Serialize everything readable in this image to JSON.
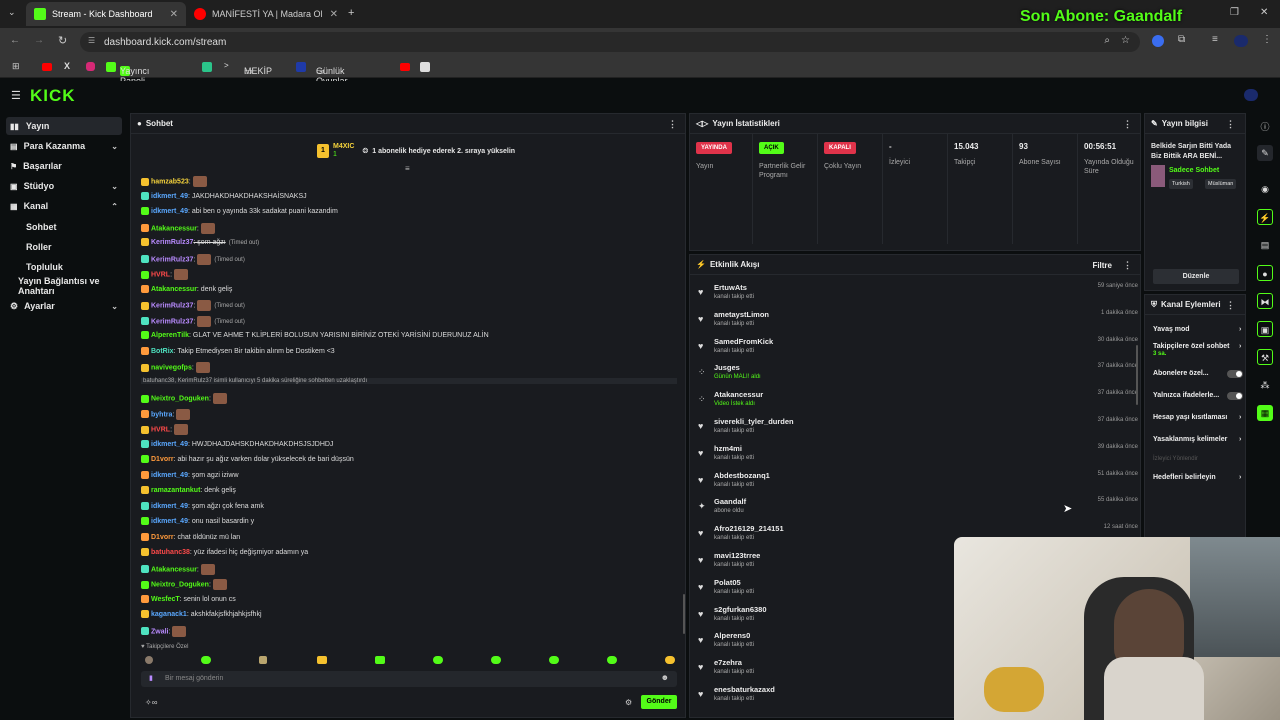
{
  "browser": {
    "tabs": [
      {
        "title": "Stream - Kick Dashboard",
        "active": true
      },
      {
        "title": "MANİFESTİ YA | Madara Olduk",
        "active": false
      }
    ],
    "url": "dashboard.kick.com/stream",
    "bookmarks": [
      "Yayıncı Paneli",
      "MEKİP",
      "Günlük Oyunlar"
    ]
  },
  "overlay": {
    "text": "Son Abone: Gaandalf"
  },
  "app": {
    "logo": "KICK"
  },
  "sidebar": {
    "items": [
      {
        "label": "Yayın"
      },
      {
        "label": "Para Kazanma"
      },
      {
        "label": "Başarılar"
      },
      {
        "label": "Stüdyo"
      },
      {
        "label": "Kanal"
      },
      {
        "label": "Yayın Bağlantısı ve Anahtarı"
      },
      {
        "label": "Ayarlar"
      }
    ],
    "sub_items": [
      "Sohbet",
      "Roller",
      "Topluluk"
    ]
  },
  "chat": {
    "title": "Sohbet",
    "pinned_user": "M4XIC",
    "pinned_count": "1",
    "pinned_text": "1 abonelik hediye ederek 2. sıraya yükselin",
    "timed_out": "(Timed out)",
    "lines": [
      {
        "user": "hamzab523",
        "msg": ":",
        "color": "u-yellow"
      },
      {
        "user": "idkmert_49",
        "msg": ": JAKDHAKDHAKDHAKSHAİSNAKSJ",
        "color": "u-blue"
      },
      {
        "user": "idkmert_49",
        "msg": ": abi ben o yayında 33k sadakat puani kazandim",
        "color": "u-blue"
      },
      {
        "user": "Atakancessur",
        "msg": ":",
        "color": "u-green"
      },
      {
        "user": "KerimRulz37",
        "msg": ": şom ağzı",
        "color": "u-purple"
      },
      {
        "user": "KerimRulz37",
        "msg": ":",
        "color": "u-purple"
      },
      {
        "user": "HVRL",
        "msg": ":",
        "color": "u-red"
      },
      {
        "user": "Atakancessur",
        "msg": ": denk geliş",
        "color": "u-green"
      },
      {
        "user": "KerimRulz37",
        "msg": ":",
        "color": "u-purple"
      },
      {
        "user": "KerimRulz37",
        "msg": ":",
        "color": "u-purple"
      },
      {
        "user": "AlperenTilk",
        "msg": ": GLAT VE AHME T KLİPLERİ BOLUSUN YARISINI BİRİNİZ OTEKİ YARİSİNİ DUERUNUZ ALİN",
        "color": "u-green"
      },
      {
        "user": "BotRix",
        "msg": ": Takip Etmediysen Bir takibin alınm be Dostikem <3",
        "color": "u-teal"
      },
      {
        "user": "navivegofps",
        "msg": ":",
        "color": "u-green"
      },
      {
        "user": "",
        "msg": "batuhanc38, KerimRulz37 isimli kullanıcıyı 5 dakika süreliğine sohbetten uzaklaştırdı",
        "color": ""
      },
      {
        "user": "Neixtro_Doguken",
        "msg": ":",
        "color": "u-green"
      },
      {
        "user": "byhtra",
        "msg": ":",
        "color": "u-blue"
      },
      {
        "user": "HVRL",
        "msg": ":",
        "color": "u-red"
      },
      {
        "user": "idkmert_49",
        "msg": ": HWJDHAJDAHSKDHAKDHAKDHSJSJDHDJ",
        "color": "u-blue"
      },
      {
        "user": "D1vorr",
        "msg": ": abi hazır şu ağız varken dolar yükselecek de bari düşsün",
        "color": "u-orange"
      },
      {
        "user": "idkmert_49",
        "msg": ": şom agzi iziww",
        "color": "u-blue"
      },
      {
        "user": "ramazantankut",
        "msg": ": denk geliş",
        "color": "u-green"
      },
      {
        "user": "idkmert_49",
        "msg": ": şom ağzı çok fena amk",
        "color": "u-blue"
      },
      {
        "user": "idkmert_49",
        "msg": ": onu nasil basardin y",
        "color": "u-blue"
      },
      {
        "user": "D1vorr",
        "msg": ": chat öldünüz mü lan",
        "color": "u-orange"
      },
      {
        "user": "batuhanc38",
        "msg": ": yüz ifadesi hiç değişmiyor adamın ya",
        "color": "u-red"
      },
      {
        "user": "Atakancessur",
        "msg": ":",
        "color": "u-green"
      },
      {
        "user": "Neixtro_Doguken",
        "msg": ":",
        "color": "u-green"
      },
      {
        "user": "WesfecT",
        "msg": ": senin lol onun cs",
        "color": "u-green"
      },
      {
        "user": "kaganack1",
        "msg": ": akshkfakjsfkhjahkjsfhkj",
        "color": "u-blue"
      },
      {
        "user": "Zwali",
        "msg": ":",
        "color": "u-purple"
      }
    ],
    "followers_only": "Takipçilere Özel",
    "input_placeholder": "Bir mesaj gönderin",
    "send_label": "Gönder"
  },
  "stats": {
    "title": "Yayın İstatistikleri",
    "live_pill": "YAYINDA",
    "live_label": "Yayın",
    "partner_pill": "AÇIK",
    "partner_label": "Partnerlik Gelir Programı",
    "multi_pill": "KAPALI",
    "multi_label": "Çoklu Yayın",
    "viewers_value": "-",
    "viewers_label": "İzleyici",
    "followers_value": "15.043",
    "followers_label": "Takipçi",
    "subs_value": "93",
    "subs_label": "Abone Sayısı",
    "uptime_value": "00:56:51",
    "uptime_label": "Yayında Olduğu Süre"
  },
  "activity": {
    "title": "Etkinlik Akışı",
    "filter_label": "Filtre",
    "events": [
      {
        "name": "ErtuwAts",
        "sub": "kanalı takip etti",
        "time": "59 saniye önce",
        "icon": "♥"
      },
      {
        "name": "ametaystLimon",
        "sub": "kanalı takip etti",
        "time": "1 dakika önce",
        "icon": "♥"
      },
      {
        "name": "SamedFromKick",
        "sub": "kanalı takip etti",
        "time": "30 dakika önce",
        "icon": "♥"
      },
      {
        "name": "Jusges",
        "sub": "Günün MALI! aldı",
        "time": "37 dakika önce",
        "icon": "⁘"
      },
      {
        "name": "Atakancessur",
        "sub": "Video İstek aldı",
        "time": "37 dakika önce",
        "icon": "⁘"
      },
      {
        "name": "siverekli_tyler_durden",
        "sub": "kanalı takip etti",
        "time": "37 dakika önce",
        "icon": "♥"
      },
      {
        "name": "hzm4mi",
        "sub": "kanalı takip etti",
        "time": "39 dakika önce",
        "icon": "♥"
      },
      {
        "name": "Abdestbozanq1",
        "sub": "kanalı takip etti",
        "time": "51 dakika önce",
        "icon": "♥"
      },
      {
        "name": "Gaandalf",
        "sub": "abone oldu",
        "time": "55 dakika önce",
        "icon": "✦"
      },
      {
        "name": "Afro216129_214151",
        "sub": "kanalı takip etti",
        "time": "12 saat önce",
        "icon": "♥"
      },
      {
        "name": "mavi123trree",
        "sub": "kanalı takip etti",
        "time": "",
        "icon": "♥"
      },
      {
        "name": "Polat05",
        "sub": "kanalı takip etti",
        "time": "",
        "icon": "♥"
      },
      {
        "name": "s2gfurkan6380",
        "sub": "kanalı takip etti",
        "time": "",
        "icon": "♥"
      },
      {
        "name": "Alperens0",
        "sub": "kanalı takip etti",
        "time": "",
        "icon": "♥"
      },
      {
        "name": "e7zehra",
        "sub": "kanalı takip etti",
        "time": "",
        "icon": "♥"
      },
      {
        "name": "enesbaturkazaxd",
        "sub": "kanalı takip etti",
        "time": "",
        "icon": "♥"
      }
    ]
  },
  "stream_info": {
    "title": "Yayın bilgisi",
    "stream_title": "Belkide Sarjın Bitti Yada Biz Bittik ARA BENİ...",
    "category": "Sadece Sohbet",
    "tags": [
      "Turkish",
      "Müslüman"
    ],
    "edit_label": "Düzenle"
  },
  "channel_actions": {
    "title": "Kanal Eylemleri",
    "items": [
      {
        "label": "Yavaş mod",
        "type": "arrow"
      },
      {
        "label": "Takipçilere özel sohbet",
        "type": "arrow",
        "sub": "3 sa."
      },
      {
        "label": "Abonelere özel...",
        "type": "toggle"
      },
      {
        "label": "Yalnızca ifadelerle...",
        "type": "toggle"
      },
      {
        "label": "Hesap yaşı kısıtlaması",
        "type": "arrow"
      },
      {
        "label": "Yasaklanmış kelimeler",
        "type": "arrow"
      },
      {
        "label": "İzleyici Yönlendir",
        "type": "disabled"
      },
      {
        "label": "Hedefleri belirleyin",
        "type": "arrow"
      }
    ]
  },
  "colors": {
    "accent": "#53fc18",
    "live": "#e0334a",
    "bg": "#0b0e0f",
    "panel": "#191b1f"
  }
}
